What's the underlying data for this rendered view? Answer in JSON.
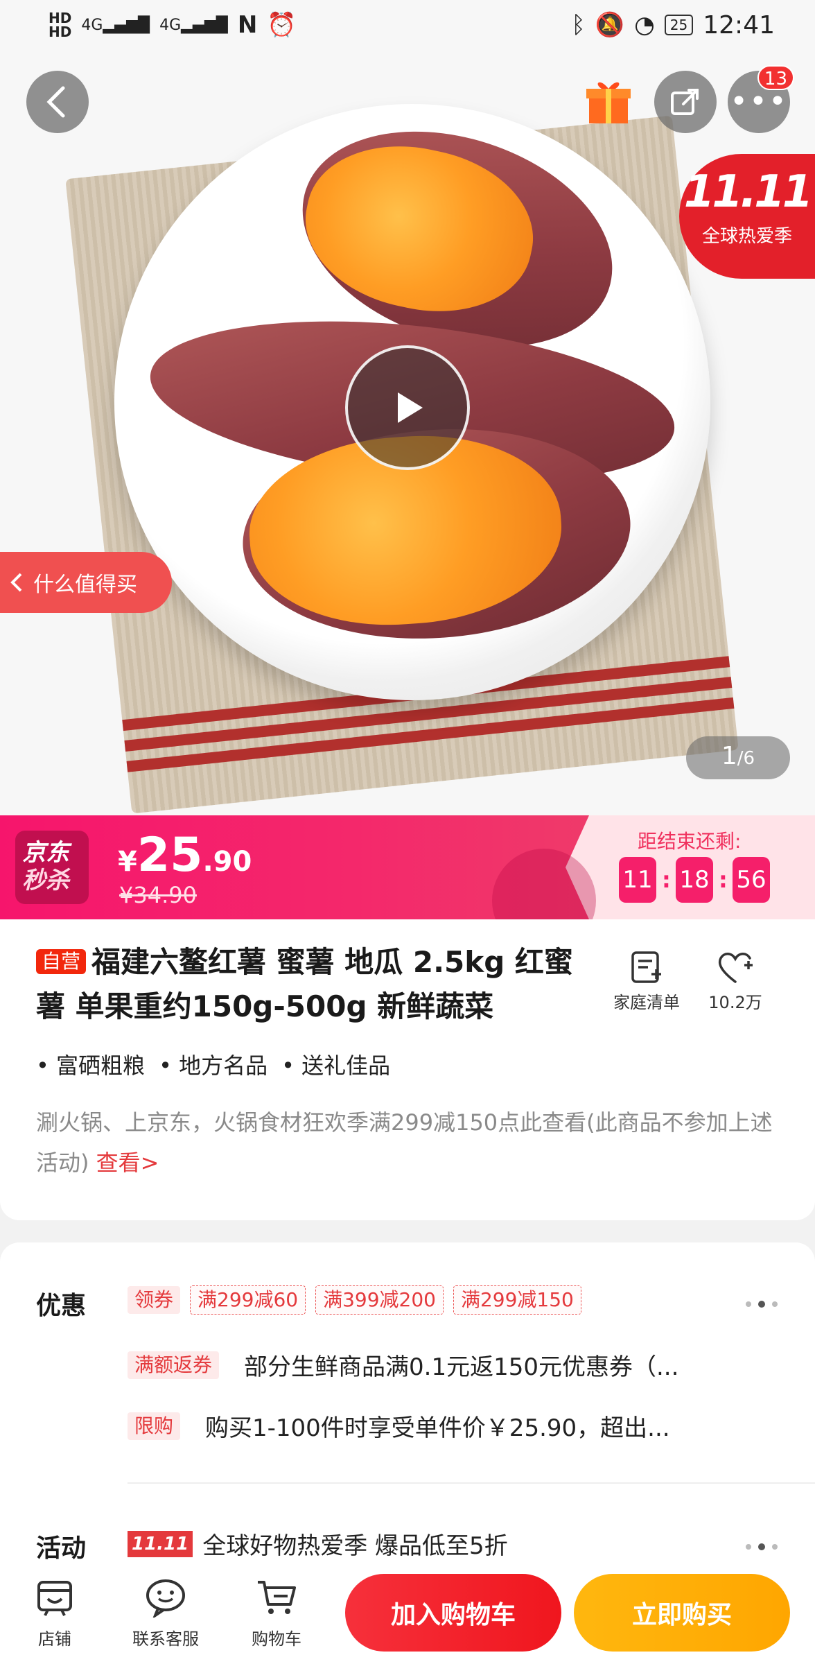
{
  "status_bar": {
    "network_left": "HD",
    "signal_1": "4G",
    "signal_2": "4G",
    "battery": "25",
    "time": "12:41"
  },
  "top_actions": {
    "more_badge_count": "13"
  },
  "promo_badge": {
    "title": "11.11",
    "subtitle": "全球热爱季"
  },
  "worth_buying_tab": "什么值得买",
  "gallery": {
    "current": "1",
    "total": "/6"
  },
  "seckill": {
    "logo_line1": "京东",
    "logo_line2": "秒杀",
    "price_symbol": "¥",
    "price_int": "25",
    "price_dec": ".90",
    "original_price": "¥34.90",
    "countdown_label": "距结束还剩:",
    "hours": "11",
    "minutes": "18",
    "seconds": "56"
  },
  "product": {
    "self_tag": "自营",
    "title": "福建六鳌红薯 蜜薯 地瓜 2.5kg  红蜜薯 单果重约150g-500g  新鲜蔬菜",
    "family_list_label": "家庭清单",
    "favorite_count": "10.2万",
    "features": [
      "富硒粗粮",
      "地方名品",
      "送礼佳品"
    ],
    "notice": "涮火锅、上京东，火锅食材狂欢季满299减150点此查看(此商品不参加上述活动)",
    "notice_link": "查看>"
  },
  "offers": {
    "section_title": "优惠",
    "coupon_tag": "领券",
    "coupons": [
      "满299减60",
      "满399减200",
      "满299减150"
    ],
    "cashback_tag": "满额返券",
    "cashback_text": "部分生鲜商品满0.1元返150元优惠券（...",
    "limit_tag": "限购",
    "limit_text": "购买1-100件时享受单件价￥25.90，超出..."
  },
  "activity": {
    "section_title": "活动",
    "logo_text": "11.11",
    "text": "全球好物热爱季 爆品低至5折"
  },
  "bottom_bar": {
    "store": "店铺",
    "service": "联系客服",
    "cart": "购物车",
    "add_to_cart": "加入购物车",
    "buy_now": "立即购买"
  }
}
